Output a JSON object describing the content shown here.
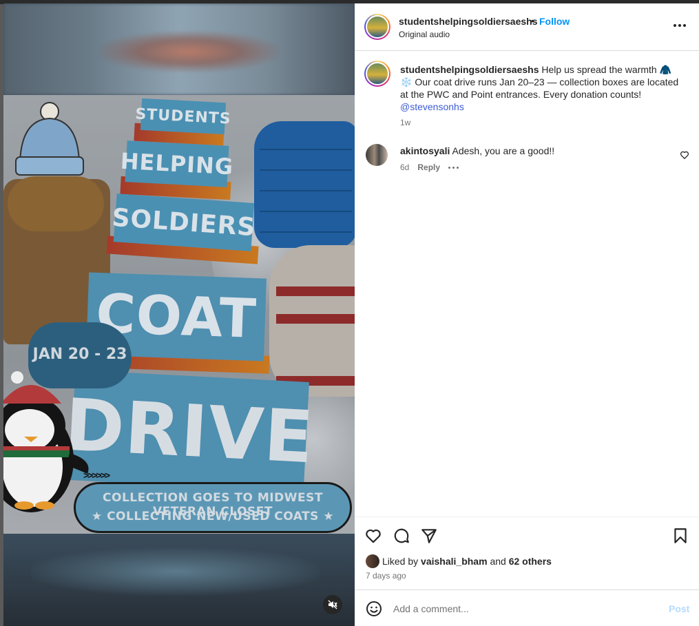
{
  "post": {
    "username": "studentshelpingsoldiersaeshs",
    "separator": "•",
    "follow_label": "Follow",
    "audio": "Original audio",
    "caption_username": "studentshelpingsoldiersaeshs",
    "caption_text": "Help us spread the warmth 🧥❄️ Our coat drive runs Jan 20–23 — collection boxes are located at the PWC and Point entrances. Every donation counts!",
    "caption_mention": "@stevensonhs",
    "caption_time": "1w"
  },
  "comments": [
    {
      "username": "akintosyali",
      "text": "Adesh, you are a good!!",
      "time": "6d",
      "reply_label": "Reply"
    }
  ],
  "likes": {
    "prefix": "Liked by",
    "user": "vaishali_bham",
    "joiner": "and",
    "others": "62 others",
    "posted": "7 days ago"
  },
  "composer": {
    "placeholder": "Add a comment...",
    "post_label": "Post"
  },
  "poster": {
    "line1": "STUDENTS",
    "line2": "HELPING",
    "line3": "SOLDIERS",
    "line4": "COAT",
    "line5": "DRIVE",
    "dates": "JAN 20 - 23",
    "banner1": "COLLECTION GOES TO MIDWEST VETERAN CLOSET",
    "banner2": "★ COLLECTING NEW/USED COATS ★"
  },
  "colors": {
    "follow": "#0095f6",
    "post_disabled": "#b3dbff",
    "muted_text": "#737373"
  }
}
